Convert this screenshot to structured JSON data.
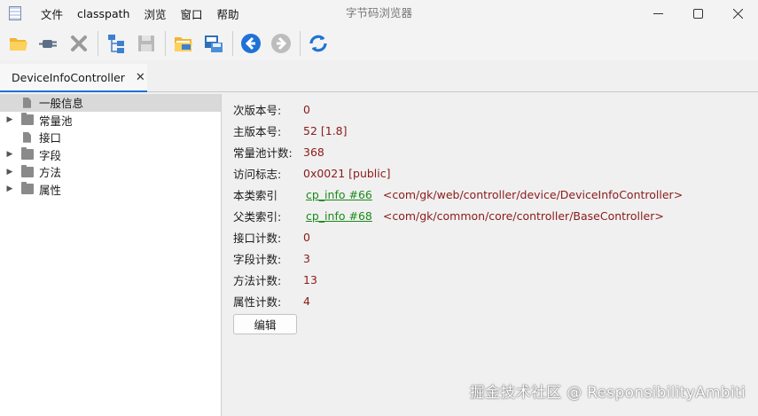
{
  "window": {
    "title": "字节码浏览器",
    "menu": [
      "文件",
      "classpath",
      "浏览",
      "窗口",
      "帮助"
    ]
  },
  "toolbar": {
    "buttons": [
      "open-folder-icon",
      "plug-icon",
      "close-x-icon",
      "tree-structure-icon",
      "save-disk-icon",
      "open-file-icon",
      "save-window-icon",
      "back-arrow-icon",
      "forward-arrow-icon",
      "refresh-icon"
    ]
  },
  "tab": {
    "label": "DeviceInfoController",
    "close": "✕"
  },
  "tree": {
    "items": [
      {
        "label": "一般信息",
        "icon": "file-icon",
        "expandable": false,
        "selected": true
      },
      {
        "label": "常量池",
        "icon": "folder-icon",
        "expandable": true
      },
      {
        "label": "接口",
        "icon": "file-icon",
        "expandable": false
      },
      {
        "label": "字段",
        "icon": "folder-icon",
        "expandable": true
      },
      {
        "label": "方法",
        "icon": "folder-icon",
        "expandable": true
      },
      {
        "label": "属性",
        "icon": "folder-icon",
        "expandable": true
      }
    ]
  },
  "detail": {
    "rows": [
      {
        "label": "次版本号:",
        "value": "0"
      },
      {
        "label": "主版本号:",
        "value": "52 [1.8]"
      },
      {
        "label": "常量池计数:",
        "value": "368"
      },
      {
        "label": "访问标志:",
        "value": "0x0021 [public]"
      },
      {
        "label": "本类索引",
        "link": "cp_info #66",
        "desc": "<com/gk/web/controller/device/DeviceInfoController>"
      },
      {
        "label": "父类索引:",
        "link": "cp_info #68",
        "desc": "<com/gk/common/core/controller/BaseController>"
      },
      {
        "label": "接口计数:",
        "value": "0"
      },
      {
        "label": "字段计数:",
        "value": "3"
      },
      {
        "label": "方法计数:",
        "value": "13"
      },
      {
        "label": "属性计数:",
        "value": "4"
      }
    ],
    "edit_button": "编辑"
  },
  "watermark": "掘金技术社区 @ ResponsibilityAmbiti",
  "colors": {
    "accent": "#1f72d6",
    "value": "#8b1a1a",
    "link": "#1a8a1a"
  }
}
